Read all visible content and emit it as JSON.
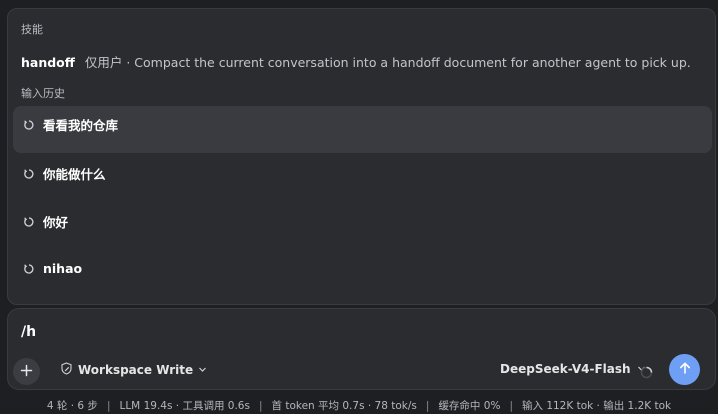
{
  "popup": {
    "skills_label": "技能",
    "skill": {
      "name": "handoff",
      "description": "仅用户 · Compact the current conversation into a handoff document for another agent to pick up."
    },
    "history_label": "输入历史",
    "history": [
      {
        "text": "看看我的仓库",
        "active": true
      },
      {
        "text": "你能做什么",
        "active": false
      },
      {
        "text": "你好",
        "active": false
      },
      {
        "text": "nihao",
        "active": false
      }
    ]
  },
  "composer": {
    "input_value": "/h",
    "mode_label": "Workspace Write",
    "model_label": "DeepSeek-V4-Flash",
    "send_color": "#6e9ff5"
  },
  "status": {
    "turns": "4 轮 · 6 步",
    "timing": "LLM 19.4s · 工具调用 0.6s",
    "first_token": "首 token 平均 0.7s · 78 tok/s",
    "cache": "缓存命中 0%",
    "tokens": "输入 112K tok · 输出 1.2K tok"
  }
}
